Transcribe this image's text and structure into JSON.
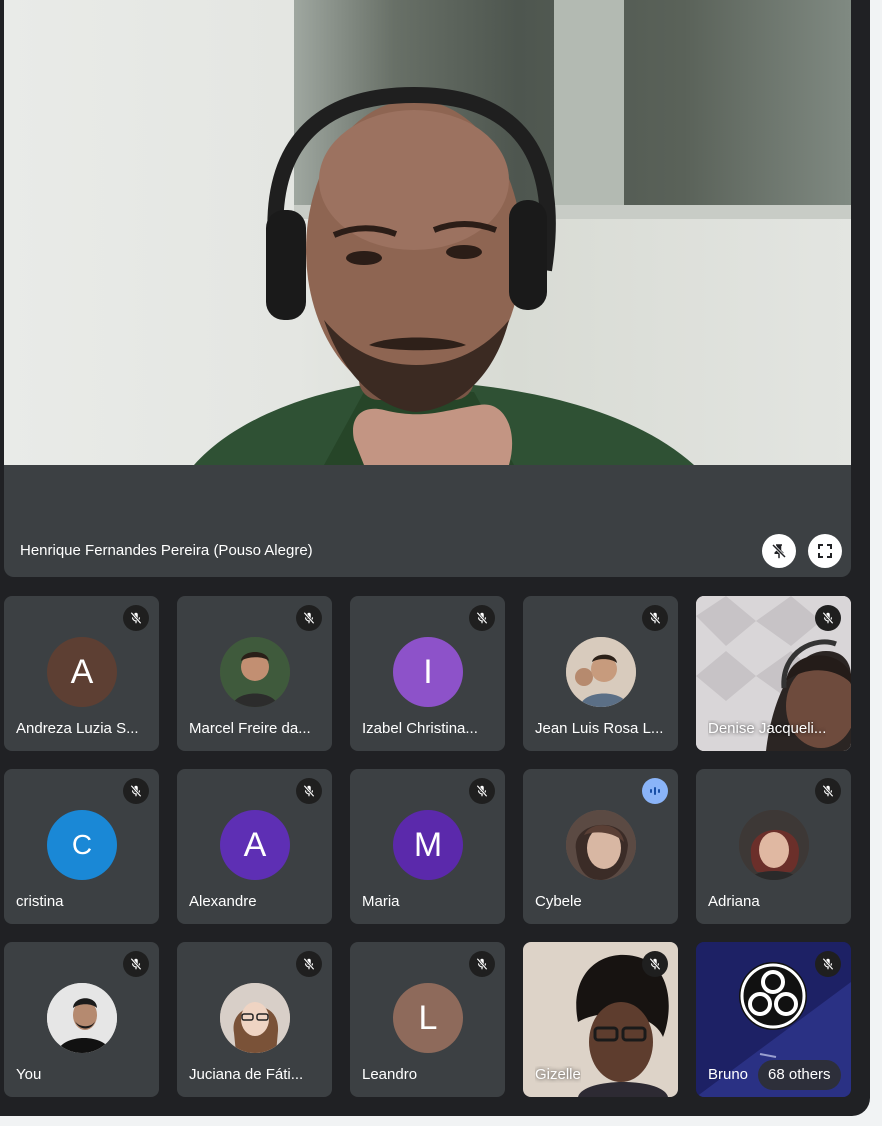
{
  "featured": {
    "name": "Henrique Fernandes Pereira (Pouso Alegre)",
    "unpin_icon": "pin-off-icon",
    "fullscreen_icon": "fullscreen-icon"
  },
  "participants": [
    {
      "name": "Andreza Luzia S...",
      "initial": "A",
      "avatar_color": "#5d3f33",
      "mic": "muted"
    },
    {
      "name": "Marcel Freire da...",
      "initial": "",
      "avatar_color": "#4b4a45",
      "mic": "muted"
    },
    {
      "name": "Izabel Christina...",
      "initial": "I",
      "avatar_color": "#8d52c9",
      "mic": "muted"
    },
    {
      "name": "Jean Luis Rosa L...",
      "initial": "",
      "avatar_color": "#9b8a7a",
      "mic": "muted"
    },
    {
      "name": "Denise Jacqueli...",
      "initial": "",
      "avatar_color": "#c9c8c9",
      "mic": "muted"
    },
    {
      "name": "cristina",
      "initial": "C",
      "avatar_color": "#1a88d6",
      "mic": "muted"
    },
    {
      "name": "Alexandre",
      "initial": "A",
      "avatar_color": "#5e2fb4",
      "mic": "muted"
    },
    {
      "name": "Maria",
      "initial": "M",
      "avatar_color": "#5b29ab",
      "mic": "muted"
    },
    {
      "name": "Cybele",
      "initial": "",
      "avatar_color": "#6b5a52",
      "mic": "speaking"
    },
    {
      "name": "Adriana",
      "initial": "",
      "avatar_color": "#4a3a33",
      "mic": "muted"
    },
    {
      "name": "You",
      "initial": "",
      "avatar_color": "#d9d9d9",
      "mic": "muted"
    },
    {
      "name": "Juciana de Fáti...",
      "initial": "",
      "avatar_color": "#b8a396",
      "mic": "muted"
    },
    {
      "name": "Leandro",
      "initial": "L",
      "avatar_color": "#8e6a5b",
      "mic": "muted"
    },
    {
      "name": "Gizelle",
      "initial": "",
      "avatar_color": "#d9cfc4",
      "mic": "muted"
    },
    {
      "name": "Bruno",
      "initial": "",
      "avatar_color": "#1b1f5b",
      "mic": "muted"
    }
  ],
  "others": {
    "label": "68 others"
  },
  "icons": {
    "mic_muted": "mic-off-icon",
    "speaking": "speaking-indicator-icon"
  },
  "colors": {
    "background": "#202124",
    "tile": "#3c4043",
    "speaking": "#8ab4f8"
  }
}
